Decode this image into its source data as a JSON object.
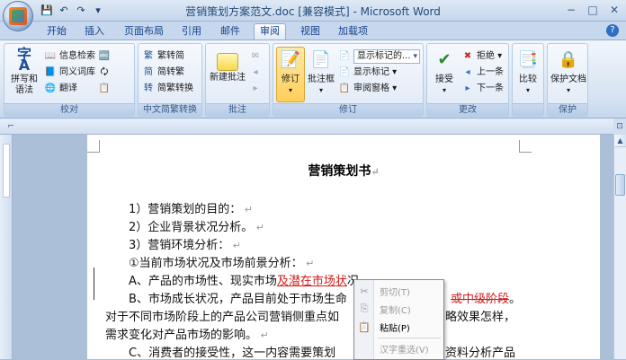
{
  "window": {
    "title": "营销策划方案范文.doc [兼容模式] - Microsoft Word",
    "minimize": "−",
    "maximize": "□",
    "close": "✕"
  },
  "qat": [
    "save-icon",
    "undo-icon",
    "redo-icon",
    "customize-icon"
  ],
  "tabs": [
    {
      "label": "开始"
    },
    {
      "label": "插入"
    },
    {
      "label": "页面布局"
    },
    {
      "label": "引用"
    },
    {
      "label": "邮件"
    },
    {
      "label": "审阅"
    },
    {
      "label": "视图"
    },
    {
      "label": "加载项"
    }
  ],
  "active_tab": "审阅",
  "ribbon": {
    "proofing": {
      "label": "校对",
      "spelling_line1": "拼写和",
      "spelling_line2": "语法",
      "research": "信息检索",
      "thesaurus": "同义词库",
      "translate": "翻译"
    },
    "chinese": {
      "label": "中文简繁转换",
      "to_traditional": "繁转简",
      "to_simplified": "简转繁",
      "convert": "简繁转换"
    },
    "comments": {
      "label": "批注",
      "new_comment": "新建批注"
    },
    "tracking": {
      "label": "修订",
      "track_changes": "修订",
      "balloons": "批注框",
      "display_combo": "显示标记的...",
      "show_markup": "显示标记 ▾",
      "reviewing_pane": "审阅窗格 ▾"
    },
    "changes": {
      "label": "更改",
      "accept": "接受",
      "reject": "拒绝 ▾",
      "previous": "上一条",
      "next": "下一条"
    },
    "compare": {
      "label": "",
      "compare": "比较"
    },
    "protect": {
      "label": "保护",
      "protect_doc": "保护文档"
    }
  },
  "document": {
    "title": "营销策划书",
    "lines": [
      "1）营销策划的目的：",
      "2）企业背景状况分析。",
      "3）营销环境分析：",
      "①当前市场状况及市场前景分析："
    ],
    "line_a_prefix": "A、产品的市场性、现实市场",
    "line_a_insert": "及潜在市场状",
    "line_a_tail": "况",
    "line_b_prefix": "B、市场成长状况，产品目前处于市场生命",
    "line_b_strike": "或中级阶段",
    "line_b_end": "。",
    "line_c_prefix": "对于不同市场阶段上的产品公司营销侧重点如",
    "line_c_tail": "略效果怎样，",
    "line_d": "需求变化对产品市场的影响。",
    "line_e_prefix": "C、消费者的接受性，这一内容需要策划",
    "line_e_tail": "资料分析产品"
  },
  "context_menu": {
    "cut": "剪切(T)",
    "copy": "复制(C)",
    "paste": "粘贴(P)",
    "reconvert": "汉字重选(V)"
  },
  "colors": {
    "revision": "#d21c1c",
    "ribbon_accent": "#15428b"
  }
}
